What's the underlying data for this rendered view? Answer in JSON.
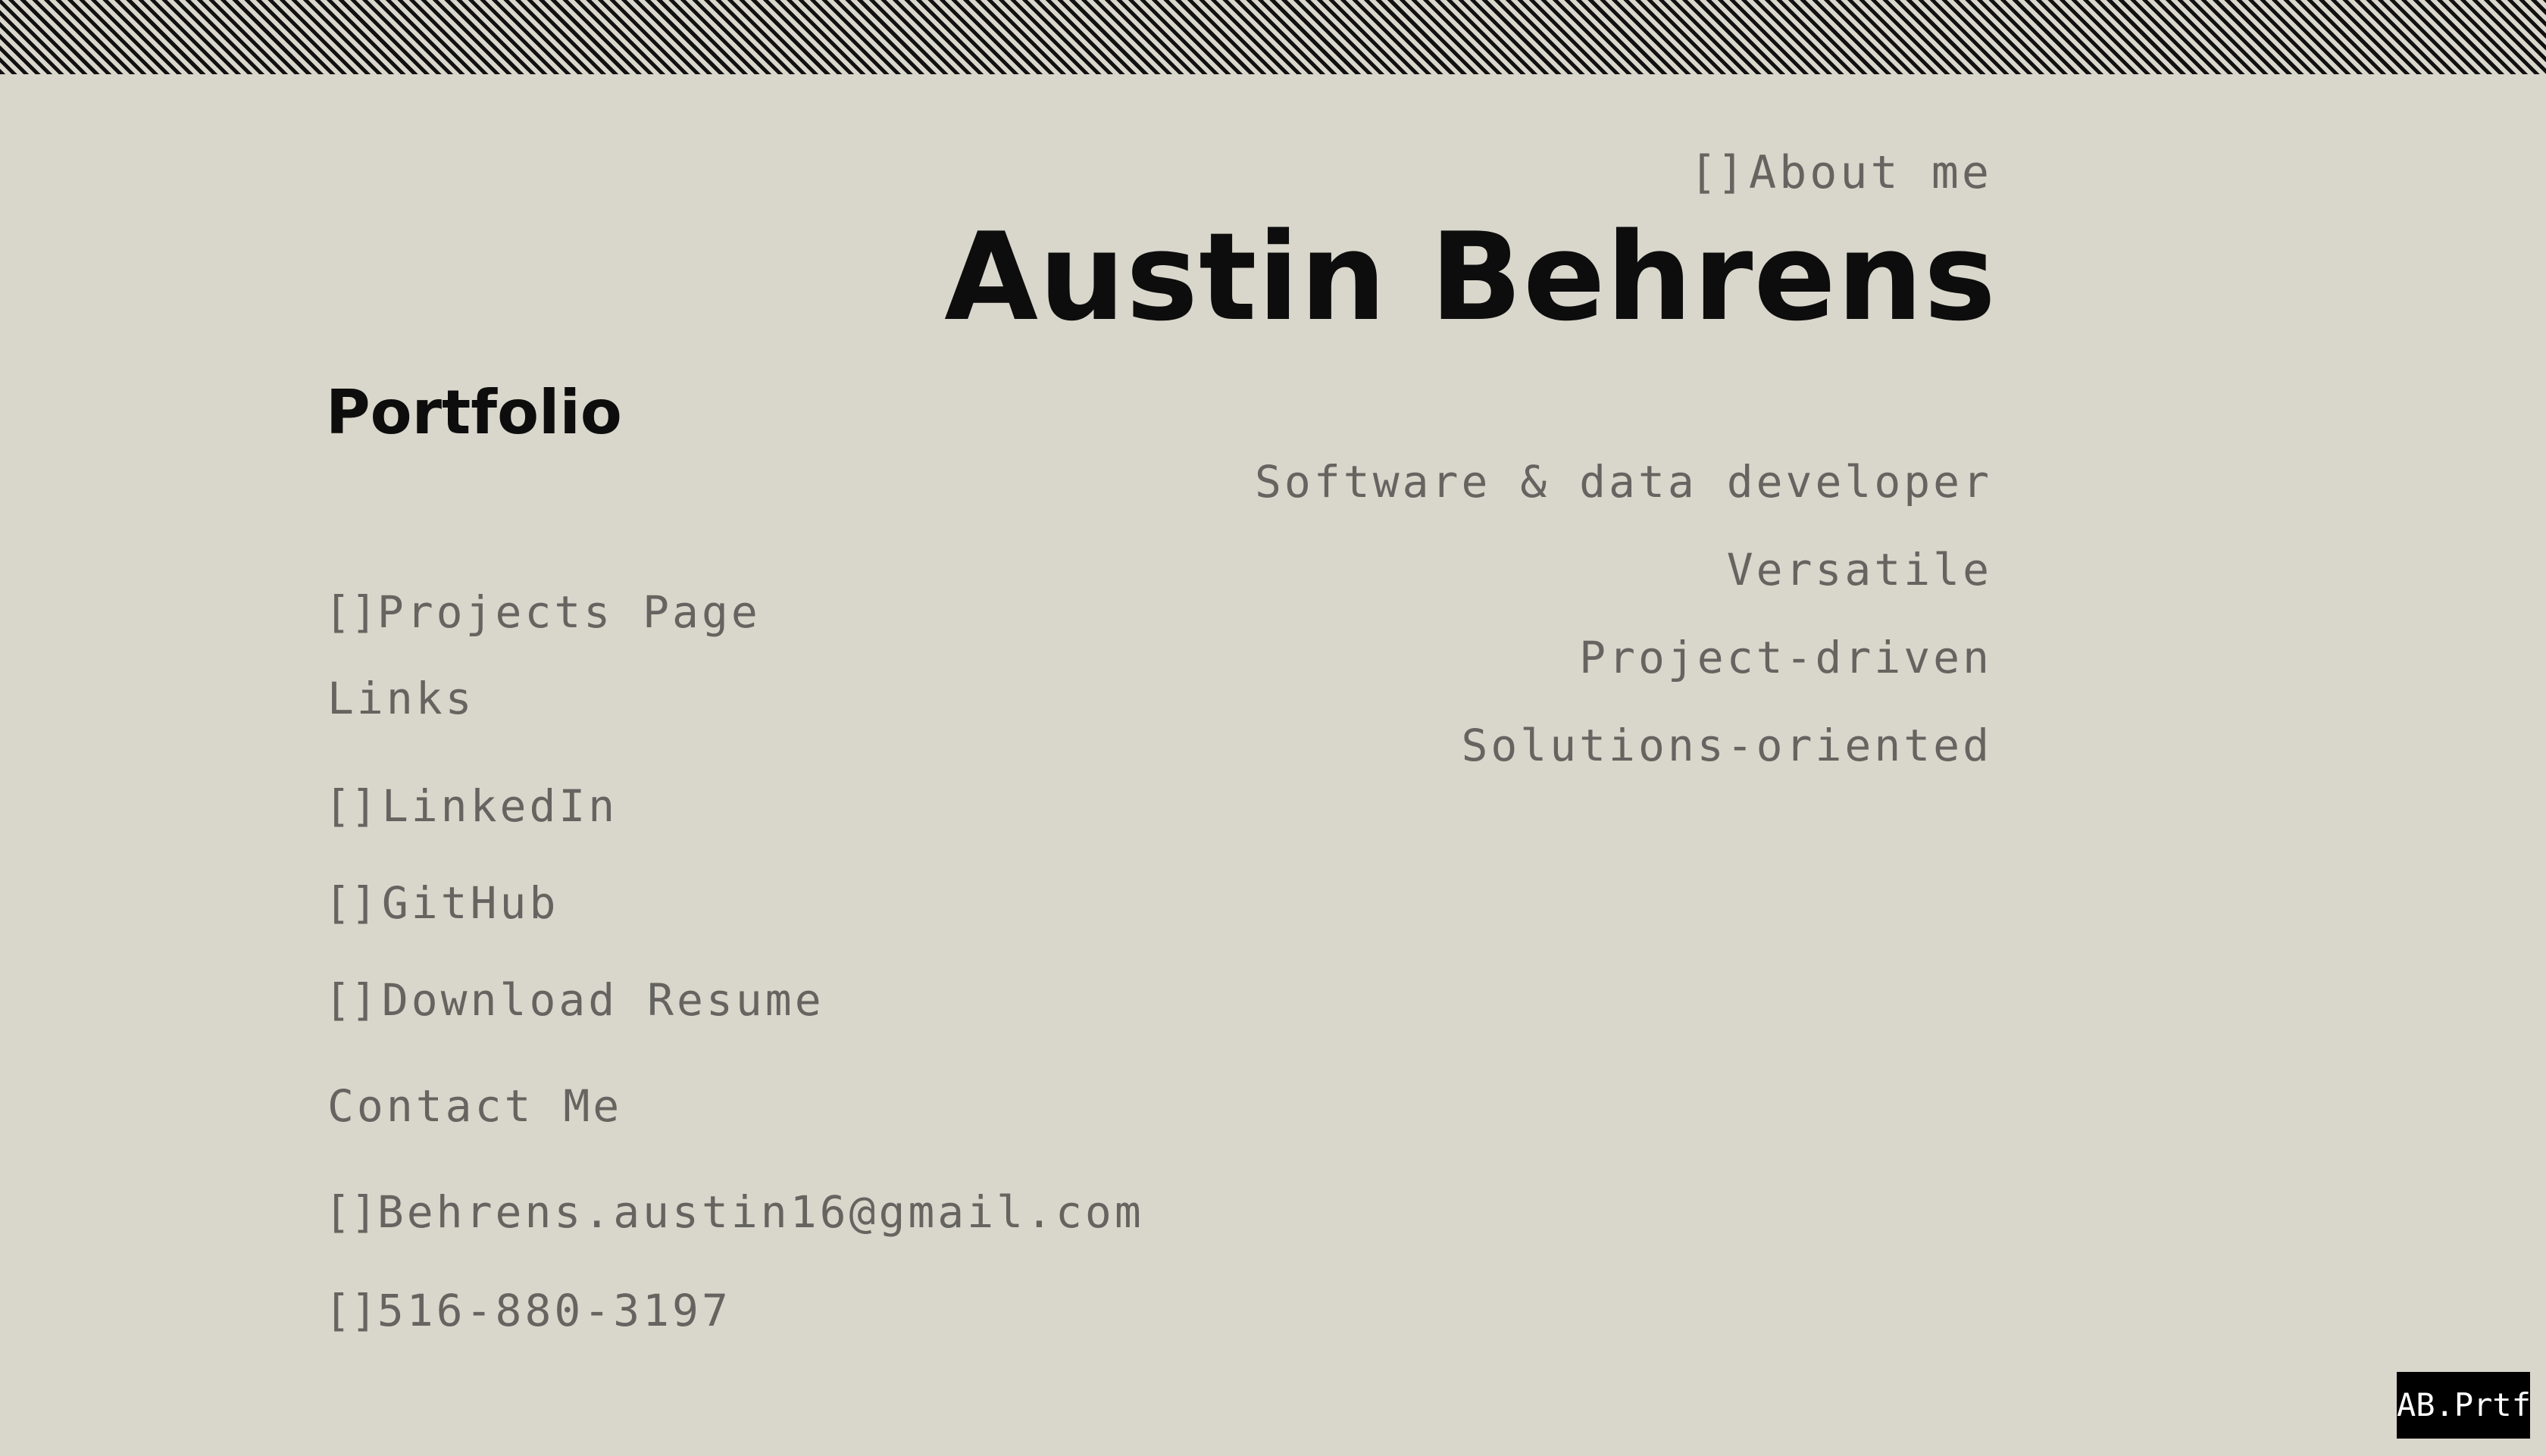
{
  "header": {
    "about_bracket": "[]",
    "about_label": "About me",
    "name": "Austin Behrens"
  },
  "portfolio": {
    "title": "Portfolio"
  },
  "nav": {
    "projects_bracket": "[]",
    "projects_label": "Projects Page"
  },
  "links": {
    "heading": "Links",
    "items": [
      {
        "bracket": "[]",
        "label": "LinkedIn"
      },
      {
        "bracket": "[]",
        "label": "GitHub"
      },
      {
        "bracket": "[]",
        "label": "Download Resume"
      }
    ]
  },
  "contact": {
    "heading": "Contact Me",
    "email_bracket": "[]",
    "email": "Behrens.austin16@gmail.com",
    "phone_bracket": "[]",
    "phone": "516-880-3197"
  },
  "taglines": [
    "Software & data developer",
    "Versatile",
    "Project-driven",
    "Solutions-oriented"
  ],
  "badge": {
    "label": "AB.Prtf"
  },
  "colors": {
    "background": "#d9d6cb",
    "stripe_dark": "#111111",
    "text_muted": "#666460",
    "text_dark": "#0d0d0d",
    "badge_bg": "#000000"
  }
}
